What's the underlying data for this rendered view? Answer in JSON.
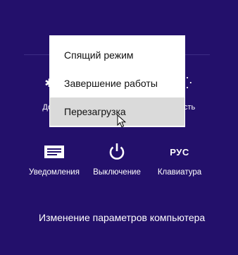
{
  "background_color": "#23106b",
  "menu": {
    "items": [
      {
        "label": "Спящий режим"
      },
      {
        "label": "Завершение работы"
      },
      {
        "label": "Перезагрузка",
        "hovered": true
      }
    ]
  },
  "tiles": {
    "left": {
      "icon": "brightness-icon",
      "label_partial": "Дос"
    },
    "right": {
      "icon": "brightness-icon",
      "label_partial": "ость"
    }
  },
  "charms": {
    "notifications": {
      "label": "Уведомления",
      "icon": "notification-icon"
    },
    "power": {
      "label": "Выключение",
      "icon": "power-icon"
    },
    "keyboard": {
      "label": "Клавиатура",
      "icon_text": "РУС"
    }
  },
  "pc_settings_link": "Изменение параметров компьютера"
}
